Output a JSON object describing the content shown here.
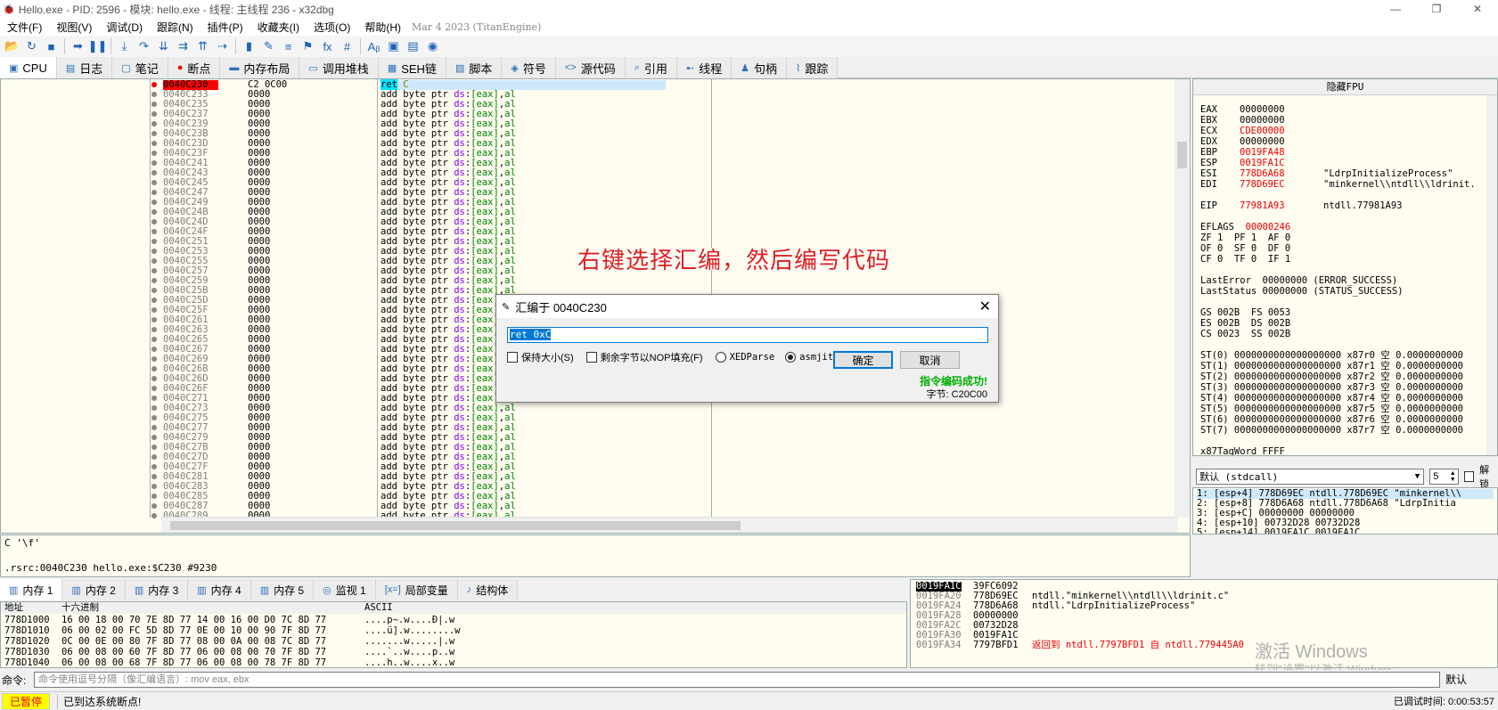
{
  "window": {
    "title": "Hello.exe - PID: 2596 - 模块: hello.exe - 线程: 主线程 236 - x32dbg",
    "controls": [
      "—",
      "❐",
      "✕"
    ]
  },
  "menu": {
    "items": [
      "文件(F)",
      "视图(V)",
      "调试(D)",
      "跟踪(N)",
      "插件(P)",
      "收藏夹(I)",
      "选项(O)",
      "帮助(H)"
    ],
    "date": "Mar 4 2023 (TitanEngine)"
  },
  "toolbar": {
    "icons": [
      "open-icon",
      "restart-icon",
      "stop-icon",
      "run-icon",
      "pause-icon",
      "step-into-icon",
      "step-over-icon",
      "trace-into-icon",
      "trace-over-icon",
      "execute-till-return-icon",
      "run-to-user-code-icon",
      "patch-icon",
      "comment-icon",
      "label-icon",
      "bookmark-icon",
      "function-icon",
      "hash-icon",
      "strings-icon",
      "calculator-icon",
      "notes-icon",
      "globe-icon"
    ],
    "glyphs": [
      "📂",
      "↻",
      "■",
      "➡",
      "❚❚",
      "⤓",
      "↷",
      "⇊",
      "⇉",
      "⇈",
      "⇢",
      "▮",
      "✎",
      "≡",
      "⚑",
      "fx",
      "#",
      "Aᵦ",
      "▣",
      "▤",
      "◉"
    ]
  },
  "tabs": [
    {
      "label": "CPU",
      "icon": "cpu-icon",
      "glyph": "▣",
      "active": true
    },
    {
      "label": "日志",
      "icon": "log-icon",
      "glyph": "▤"
    },
    {
      "label": "笔记",
      "icon": "notes-icon",
      "glyph": "▢"
    },
    {
      "label": "断点",
      "icon": "breakpoint-icon",
      "glyph": "●"
    },
    {
      "label": "内存布局",
      "icon": "memory-map-icon",
      "glyph": "▬"
    },
    {
      "label": "调用堆栈",
      "icon": "call-stack-icon",
      "glyph": "▭"
    },
    {
      "label": "SEH链",
      "icon": "seh-icon",
      "glyph": "▦"
    },
    {
      "label": "脚本",
      "icon": "script-icon",
      "glyph": "▧"
    },
    {
      "label": "符号",
      "icon": "symbols-icon",
      "glyph": "◈"
    },
    {
      "label": "源代码",
      "icon": "source-icon",
      "glyph": "<>"
    },
    {
      "label": "引用",
      "icon": "references-icon",
      "glyph": "⌕"
    },
    {
      "label": "线程",
      "icon": "threads-icon",
      "glyph": "➸"
    },
    {
      "label": "句柄",
      "icon": "handles-icon",
      "glyph": "♟"
    },
    {
      "label": "跟踪",
      "icon": "trace-icon",
      "glyph": "⌇"
    }
  ],
  "disasm": {
    "first": {
      "address": "0040C230",
      "bytes": "C2 0C00",
      "instr": "ret",
      "arg": "C"
    },
    "addresses": [
      "0040C233",
      "0040C235",
      "0040C237",
      "0040C239",
      "0040C23B",
      "0040C23D",
      "0040C23F",
      "0040C241",
      "0040C243",
      "0040C245",
      "0040C247",
      "0040C249",
      "0040C24B",
      "0040C24D",
      "0040C24F",
      "0040C251",
      "0040C253",
      "0040C255",
      "0040C257",
      "0040C259",
      "0040C25B",
      "0040C25D",
      "0040C25F",
      "0040C261",
      "0040C263",
      "0040C265",
      "0040C267",
      "0040C269",
      "0040C26B",
      "0040C26D",
      "0040C26F",
      "0040C271",
      "0040C273",
      "0040C275",
      "0040C277",
      "0040C279",
      "0040C27B",
      "0040C27D",
      "0040C27F",
      "0040C281",
      "0040C283",
      "0040C285",
      "0040C287",
      "0040C289"
    ],
    "row_bytes": "0000",
    "row_instr": {
      "op": "add",
      "size": "byte ptr",
      "seg": "ds",
      "mem": "[eax]",
      "src": "al"
    }
  },
  "annotation": "右键选择汇编，然后编写代码",
  "dialog": {
    "title": "汇编于 0040C230",
    "input_value": "ret 0xC",
    "keep_size": "保持大小(S)",
    "fill_nop": "剩余字节以NOP填充(F)",
    "xedparse": "XEDParse",
    "asmjit": "asmjit",
    "ok": "确定",
    "cancel": "取消",
    "success": "指令编码成功!",
    "bytes": "字节: C20C00"
  },
  "info": {
    "line1": "C '\\f'",
    "line2": ".rsrc:0040C230 hello.exe:$C230 #9230"
  },
  "registers": {
    "header": "隐藏FPU",
    "gp": [
      {
        "n": "EAX",
        "v": "00000000",
        "c": ""
      },
      {
        "n": "EBX",
        "v": "00000000",
        "c": ""
      },
      {
        "n": "ECX",
        "v": "CDE00000",
        "c": ""
      },
      {
        "n": "EDX",
        "v": "00000000",
        "c": ""
      },
      {
        "n": "EBP",
        "v": "0019FA48",
        "c": ""
      },
      {
        "n": "ESP",
        "v": "0019FA1C",
        "c": ""
      },
      {
        "n": "ESI",
        "v": "778D6A68",
        "c": "\"LdrpInitializeProcess\""
      },
      {
        "n": "EDI",
        "v": "778D69EC",
        "c": "\"minkernel\\\\ntdll\\\\ldrinit."
      }
    ],
    "eip": {
      "n": "EIP",
      "v": "77981A93",
      "c": "ntdll.77981A93"
    },
    "eflags": {
      "n": "EFLAGS",
      "v": "00000246"
    },
    "flags": [
      "ZF 1  PF 1  AF 0",
      "OF 0  SF 0  DF 0",
      "CF 0  TF 0  IF 1"
    ],
    "lasterror": "LastError  00000000 (ERROR_SUCCESS)",
    "laststatus": "LastStatus 00000000 (STATUS_SUCCESS)",
    "segs": [
      "GS 002B  FS 0053",
      "ES 002B  DS 002B",
      "CS 0023  SS 002B"
    ],
    "st": [
      "ST(0) 0000000000000000000 x87r0 空 0.0000000000",
      "ST(1) 0000000000000000000 x87r1 空 0.0000000000",
      "ST(2) 0000000000000000000 x87r2 空 0.0000000000",
      "ST(3) 0000000000000000000 x87r3 空 0.0000000000",
      "ST(4) 0000000000000000000 x87r4 空 0.0000000000",
      "ST(5) 0000000000000000000 x87r5 空 0.0000000000",
      "ST(6) 0000000000000000000 x87r6 空 0.0000000000",
      "ST(7) 0000000000000000000 x87r7 空 0.0000000000"
    ],
    "tagword": "x87TagWord FFFF"
  },
  "args": {
    "convention": "默认 (stdcall)",
    "count": "5",
    "unlock": "解锁",
    "rows": [
      "1: [esp+4] 778D69EC ntdll.778D69EC \"minkernel\\\\",
      "2: [esp+8] 778D6A68 ntdll.778D6A68 \"LdrpInitia",
      "3: [esp+C] 00000000 00000000",
      "4: [esp+10] 00732D28 00732D28",
      "5: [esp+14] 0019FA1C 0019FA1C"
    ]
  },
  "bottom_tabs": [
    {
      "label": "内存 1",
      "icon": "memory-icon",
      "active": true
    },
    {
      "label": "内存 2",
      "icon": "memory-icon"
    },
    {
      "label": "内存 3",
      "icon": "memory-icon"
    },
    {
      "label": "内存 4",
      "icon": "memory-icon"
    },
    {
      "label": "内存 5",
      "icon": "memory-icon"
    },
    {
      "label": "监视 1",
      "icon": "watch-icon"
    },
    {
      "label": "局部变量",
      "icon": "locals-icon"
    },
    {
      "label": "结构体",
      "icon": "struct-icon"
    }
  ],
  "dump": {
    "headers": {
      "addr": "地址",
      "hex": "十六进制",
      "ascii": "ASCII"
    },
    "rows": [
      {
        "a": "778D1000",
        "h": "16 00 18 00 70 7E 8D 77 14 00 16 00 D0 7C 8D 77",
        "c": "....p~.w....Ð|.w"
      },
      {
        "a": "778D1010",
        "h": "06 00 02 00 FC 5D 8D 77 0E 00 10 00 90 7F 8D 77",
        "c": "....ü].w........w"
      },
      {
        "a": "778D1020",
        "h": "0C 00 0E 00 80 7F 8D 77 08 00 0A 00 08 7C 8D 77",
        "c": ".......w.....|.w"
      },
      {
        "a": "778D1030",
        "h": "06 00 08 00 60 7F 8D 77 06 00 08 00 70 7F 8D 77",
        "c": "....`..w....p..w"
      },
      {
        "a": "778D1040",
        "h": "06 00 08 00 68 7F 8D 77 06 00 08 00 78 7F 8D 77",
        "c": "....h..w....x..w"
      }
    ]
  },
  "stack": {
    "rows": [
      {
        "a": "0019FA1C",
        "v": "39FC6092",
        "c": ""
      },
      {
        "a": "0019FA20",
        "v": "778D69EC",
        "c": "ntdll.\"minkernel\\\\ntdll\\\\ldrinit.c\""
      },
      {
        "a": "0019FA24",
        "v": "778D6A68",
        "c": "ntdll.\"LdrpInitializeProcess\""
      },
      {
        "a": "0019FA28",
        "v": "00000000",
        "c": ""
      },
      {
        "a": "0019FA2C",
        "v": "00732D28",
        "c": ""
      },
      {
        "a": "0019FA30",
        "v": "0019FA1C",
        "c": ""
      },
      {
        "a": "0019FA34",
        "v": "7797BFD1",
        "c": "返回到 ntdll.7797BFD1 自 ntdll.779445A0"
      }
    ]
  },
  "watermark": {
    "line1": "激活 Windows",
    "line2": "转到\"设置\"以激活 Windows。"
  },
  "command": {
    "label": "命令:",
    "placeholder": "命令使用逗号分隔（像汇编语言）: mov eax, ebx",
    "mode": "默认"
  },
  "status": {
    "state": "已暂停",
    "message": "已到达系统断点!",
    "time": "已调试时间:  0:00:53:57"
  },
  "colors": {
    "accent": "#0078d7",
    "register_changed": "#e00000",
    "paused_bg": "#ffff00"
  }
}
